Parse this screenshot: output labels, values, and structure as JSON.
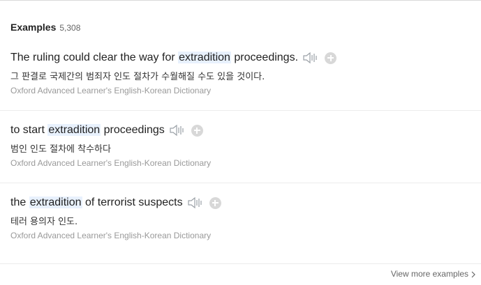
{
  "header": {
    "title": "Examples",
    "count": "5,308"
  },
  "examples": [
    {
      "before": "The ruling could clear the way for ",
      "highlight": "extradition",
      "after": " proceedings.",
      "translation": "그 판결로 국제간의 범죄자 인도 절차가 수월해질 수도 있을 것이다.",
      "source": "Oxford Advanced Learner's English-Korean Dictionary"
    },
    {
      "before": "to start ",
      "highlight": "extradition",
      "after": " proceedings",
      "translation": "범인 인도 절차에 착수하다",
      "source": "Oxford Advanced Learner's English-Korean Dictionary"
    },
    {
      "before": "the ",
      "highlight": "extradition",
      "after": " of terrorist suspects",
      "translation": "테러 용의자 인도.",
      "source": "Oxford Advanced Learner's English-Korean Dictionary"
    }
  ],
  "footer": {
    "view_more_label": "View more examples"
  },
  "icons": {
    "speaker": "speaker-icon",
    "add": "plus-icon",
    "chevron": "chevron-right-icon"
  },
  "colors": {
    "highlight": "#e8f1fd",
    "source_text": "#999999",
    "icon_gray": "#9aa0a6"
  }
}
